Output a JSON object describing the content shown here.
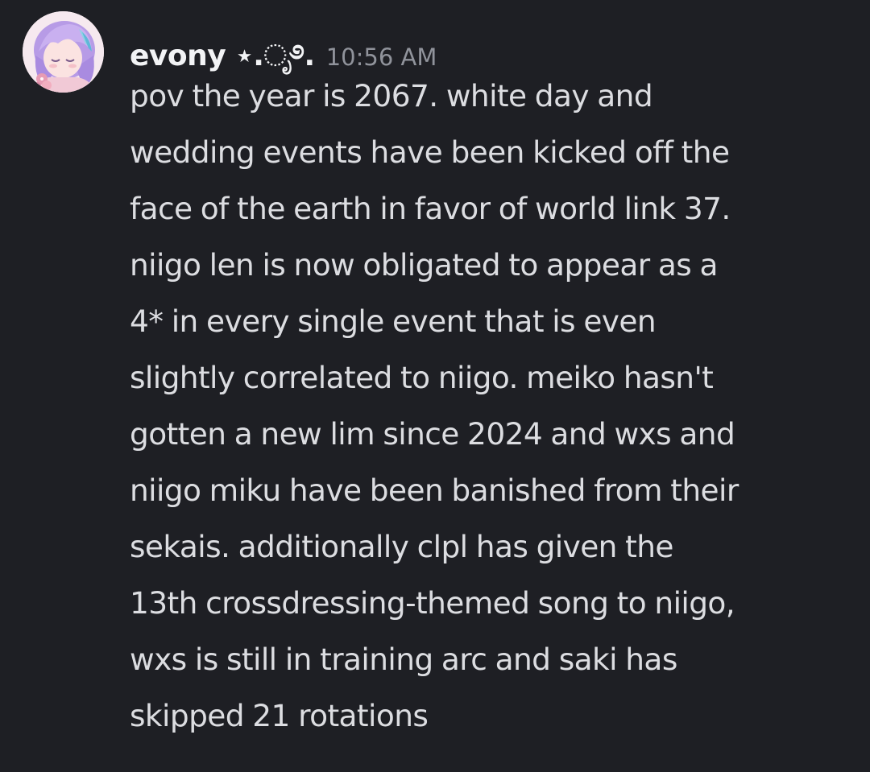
{
  "message": {
    "author": "evony ⋆.ೃ࿔.",
    "timestamp": "10:56 AM",
    "lines": [
      "pov the year is 2067. white day and",
      "wedding events have been kicked off the",
      "face of the earth in favor of world link 37.",
      "niigo len is now obligated to appear as a",
      "4* in every single event that is even",
      "slightly correlated to niigo. meiko hasn't",
      "gotten a new lim since 2024 and wxs and",
      "niigo miku have been banished from their",
      "sekais. additionally clpl has given the",
      "13th crossdressing-themed song to niigo,",
      "wxs is still in training arc and saki has",
      "skipped 21 rotations"
    ]
  },
  "colors": {
    "background": "#1e1f24",
    "username": "#f2f3f5",
    "timestamp": "#90939b",
    "text": "#dcdde1"
  }
}
